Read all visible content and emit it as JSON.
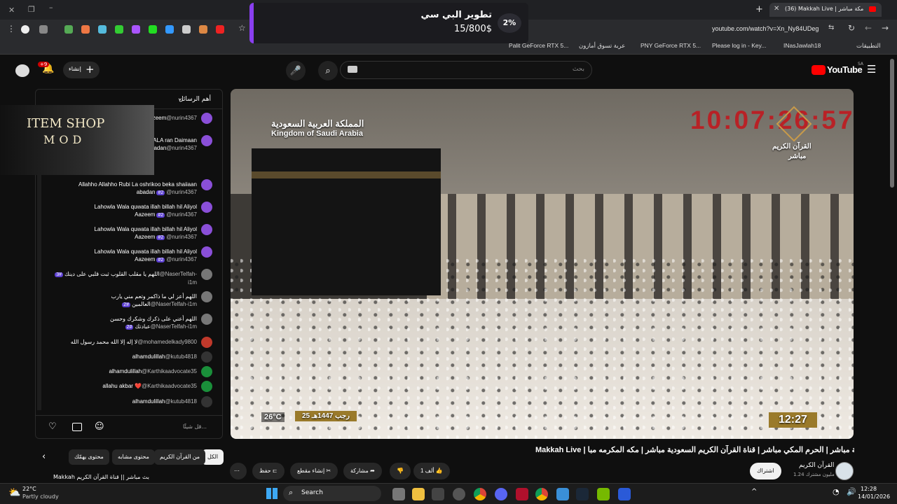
{
  "browser": {
    "tab_title": "(36) Makkah Live | مكة مباشر",
    "address": "youtube.com/watch?v=Xn_Ny84UDeg",
    "bookmarks": [
      "التطبيقات",
      "INasJawlah18",
      "Please log in - Key...",
      "PNY GeForce RTX 5...",
      "عربة تسوق أمازون",
      "Palit GeForce RTX 5..."
    ]
  },
  "toast": {
    "title": "تطوير البي سي",
    "amount": "15/800$",
    "percent": "2%"
  },
  "header": {
    "logo": "YouTube",
    "logo_region": "SA",
    "search_placeholder": "بحث",
    "create_label": "إنشاء",
    "notif_count": "+9"
  },
  "chat": {
    "title": "أهم الرسائل",
    "input_placeholder": "قل شيئًا...",
    "overlay_logo_line1": "ITEM SHOP",
    "overlay_logo_line2": "MOD",
    "messages": [
      {
        "author": "@nurin4367",
        "text": "ah Hil Azeem",
        "badge": ""
      },
      {
        "author": "@nurin4367",
        "text": "h Hil Azeem. Nabi Wa ALA ran Daimaan Abadan",
        "badge": ""
      },
      {
        "author": "@nurin4367",
        "text": "Allahho Allahho Rubi La oshrikoo beka shaiiaan abadan",
        "badge": "#2"
      },
      {
        "author": "@nurin4367",
        "text": "Lahowla Wala quwata illah billah hil Aliyol Aazeem",
        "badge": "#2"
      },
      {
        "author": "@nurin4367",
        "text": "Lahowla Wala quwata illah billah hil Aliyol Aazeem",
        "badge": "#2"
      },
      {
        "author": "@nurin4367",
        "text": "Lahowla Wala quwata illah billah hil Aliyol Aazeem",
        "badge": "#2"
      },
      {
        "author": "@NaserTelfah-i1m",
        "text": "اللهم يا مقلب القلوب ثبت قلبي على دينك",
        "badge": "#3"
      },
      {
        "author": "@NaserTelfah-i1m",
        "text": "اللهم أعز لي ما ذاكمر وتعم مني يارب العالمين",
        "badge": "#2"
      },
      {
        "author": "@NaserTelfah-i1m",
        "text": "اللهم أعني على ذكرك وشكرك وحسن عبادتك",
        "badge": "#2"
      },
      {
        "author": "@mohamedelkady9800",
        "text": "لا إله إلا الله محمد رسول الله",
        "badge": ""
      },
      {
        "author": "@kutub4818",
        "text": "alhamdulillah",
        "badge": ""
      },
      {
        "author": "@Karthikaadvocate35",
        "text": "alhamdulillah",
        "badge": ""
      },
      {
        "author": "@Karthikaadvocate35",
        "text": "allahu akbar ❤️",
        "badge": ""
      },
      {
        "author": "@kutub4818",
        "text": "alhamdulillah",
        "badge": ""
      }
    ]
  },
  "video": {
    "overlay_arabic": "المملكة العربية السعودية",
    "overlay_english": "Kingdom of Saudi Arabia",
    "clock": "10:07:26:57",
    "channel_overlay": "القرآن الكريم",
    "live_label": "مباشر",
    "temperature": "26°C",
    "hijri_date": "25 رجب 1447هـ",
    "time_badge": "12:27"
  },
  "below_video": {
    "title": "Makkah Live | مكة مباشر | الحرم المكي مباشر | قناة القرآن الكريم السعودية مباشر | مكه المكرمه مبا",
    "channel_name": "القرآن الكريم",
    "subscribers": "1.24 مليون مشترك",
    "subscribe_label": "اشتراك",
    "like_count": "1 ألف",
    "share_label": "مشاركة",
    "clip_label": "إنشاء مقطع",
    "save_label": "حفظ",
    "chips": [
      "الكل",
      "من القرآن الكريم",
      "محتوى مشابه",
      "محتوى يهمّك"
    ],
    "next_video": "Makkah بث مباشر || قناة القرآن الكريم"
  },
  "taskbar": {
    "weather_temp": "22°C",
    "weather_desc": "Partly cloudy",
    "search_label": "Search",
    "time": "12:28",
    "date": "14/01/2026"
  },
  "colors": {
    "accent": "#8a3ff0",
    "youtube_red": "#ff0000",
    "clock_red": "#c4141b"
  }
}
